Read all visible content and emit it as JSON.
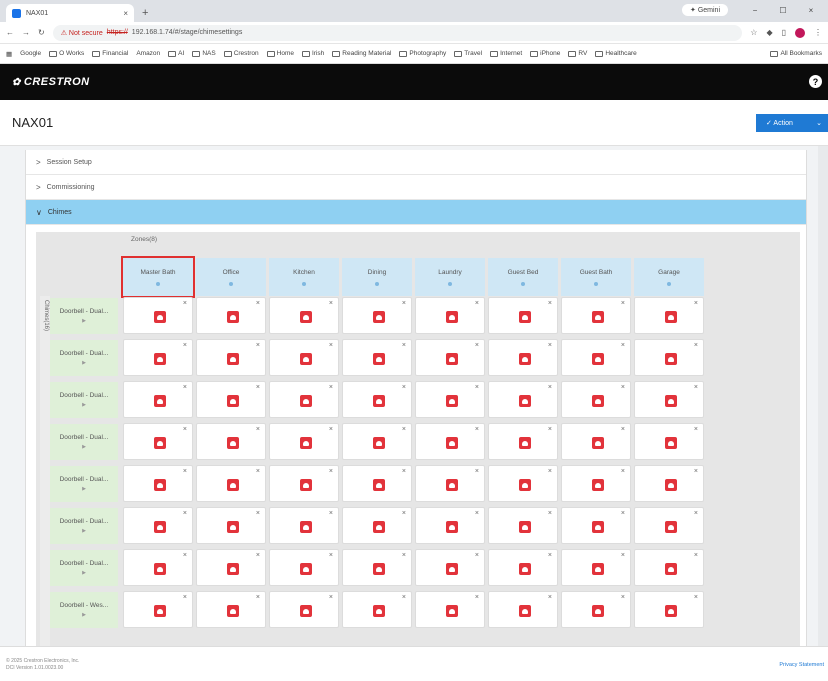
{
  "browser": {
    "tab_title": "NAX01",
    "tab_close": "×",
    "new_tab": "+",
    "gemini": "✦ Gemini",
    "minimize": "−",
    "restore": "☐",
    "close": "×",
    "not_secure": "⚠ Not secure",
    "url_proto": "https://",
    "url_rest": "192.168.1.74/#/stage/chimesettings",
    "bookmarks": [
      "Google",
      "O Works",
      "Financial",
      "Amazon",
      "AI",
      "NAS",
      "Crestron",
      "Home",
      "Irish",
      "Reading Material",
      "Photography",
      "Travel",
      "Internet",
      "iPhone",
      "RV",
      "Healthcare"
    ],
    "all_bookmarks": "All Bookmarks"
  },
  "app": {
    "logo": "CRESTRON",
    "logo_mark": "✿",
    "help": "?",
    "device_name": "NAX01",
    "action_label": "✓  Action",
    "action_chevron": "⌄"
  },
  "accordion": [
    {
      "label": "Session Setup",
      "chev": ">"
    },
    {
      "label": "Commissioning",
      "chev": ">"
    },
    {
      "label": "Chimes",
      "chev": "∨"
    }
  ],
  "grid": {
    "zones_header": "Zones(8)",
    "vertical_label": "Chimes(16)",
    "columns": [
      "Master Bath",
      "Office",
      "Kitchen",
      "Dining",
      "Laundry",
      "Guest Bed",
      "Guest Bath",
      "Garage"
    ],
    "rows": [
      "Doorbell - Dual...",
      "Doorbell - Dual...",
      "Doorbell - Dual...",
      "Doorbell - Dual...",
      "Doorbell - Dual...",
      "Doorbell - Dual...",
      "Doorbell - Dual...",
      "Doorbell - Wes..."
    ],
    "play_glyph": "▶",
    "close_glyph": "×"
  },
  "footer": {
    "copyright": "© 2025 Crestron Electronics, Inc.",
    "version": "DCI Version 1.01.0023.00",
    "privacy": "Privacy Statement"
  }
}
